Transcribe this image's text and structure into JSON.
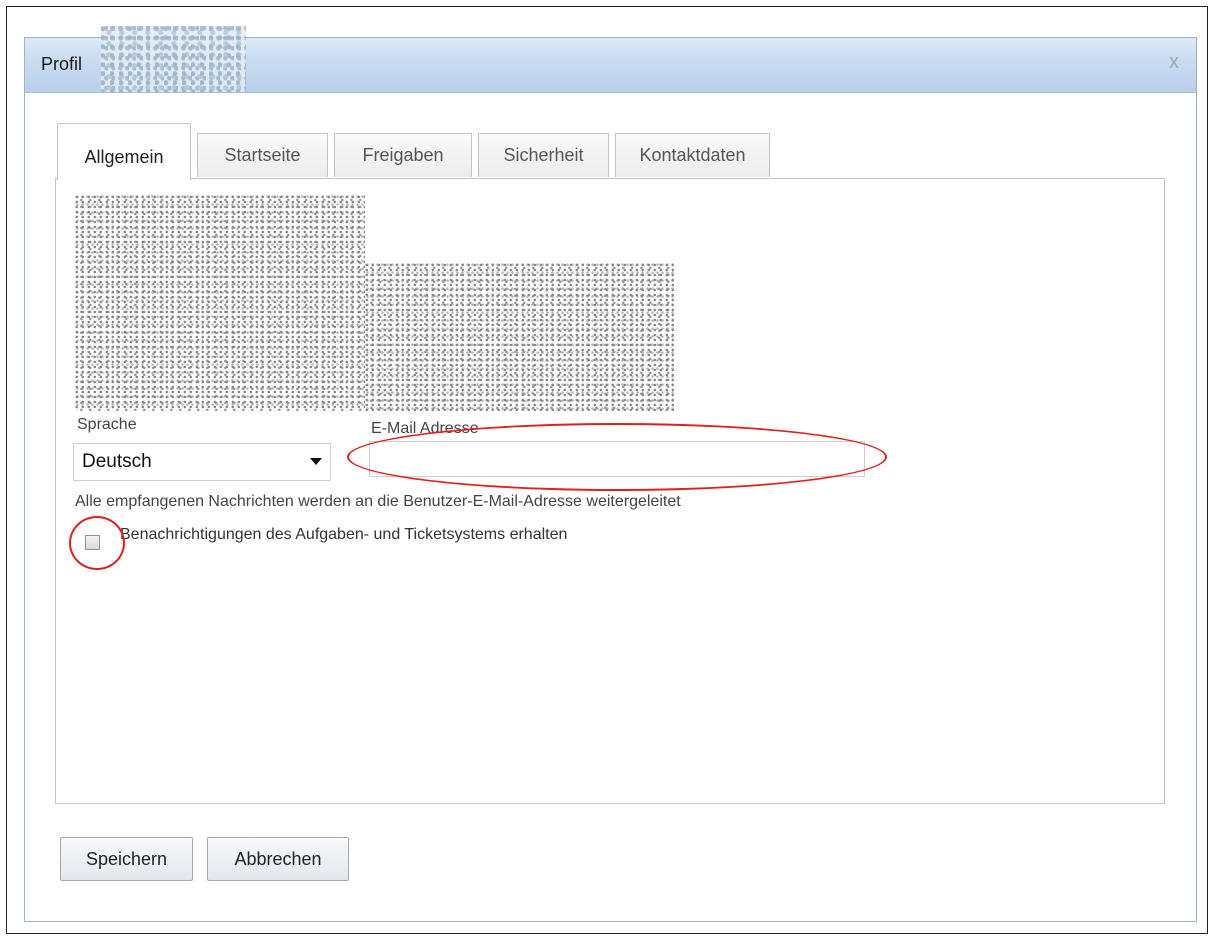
{
  "dialog": {
    "title": "Profil",
    "close_glyph": "x"
  },
  "tabs": [
    {
      "label": "Allgemein",
      "active": true
    },
    {
      "label": "Startseite",
      "active": false
    },
    {
      "label": "Freigaben",
      "active": false
    },
    {
      "label": "Sicherheit",
      "active": false
    },
    {
      "label": "Kontaktdaten",
      "active": false
    }
  ],
  "form": {
    "language_label": "Sprache",
    "language_value": "Deutsch",
    "email_label": "E-Mail Adresse",
    "email_value": "",
    "forward_info": "Alle empfangenen Nachrichten werden an die Benutzer-E-Mail-Adresse weitergeleitet",
    "notify_label": "Benachrichtigungen des Aufgaben- und Ticketsystems erhalten",
    "notify_checked": false
  },
  "footer": {
    "save_label": "Speichern",
    "cancel_label": "Abbrechen"
  },
  "icons": {
    "close": "close-icon",
    "dropdown": "chevron-down-icon"
  },
  "colors": {
    "titlebar": "#c8dbf1",
    "annotation": "#e0201c",
    "border": "#c4c4c4"
  }
}
